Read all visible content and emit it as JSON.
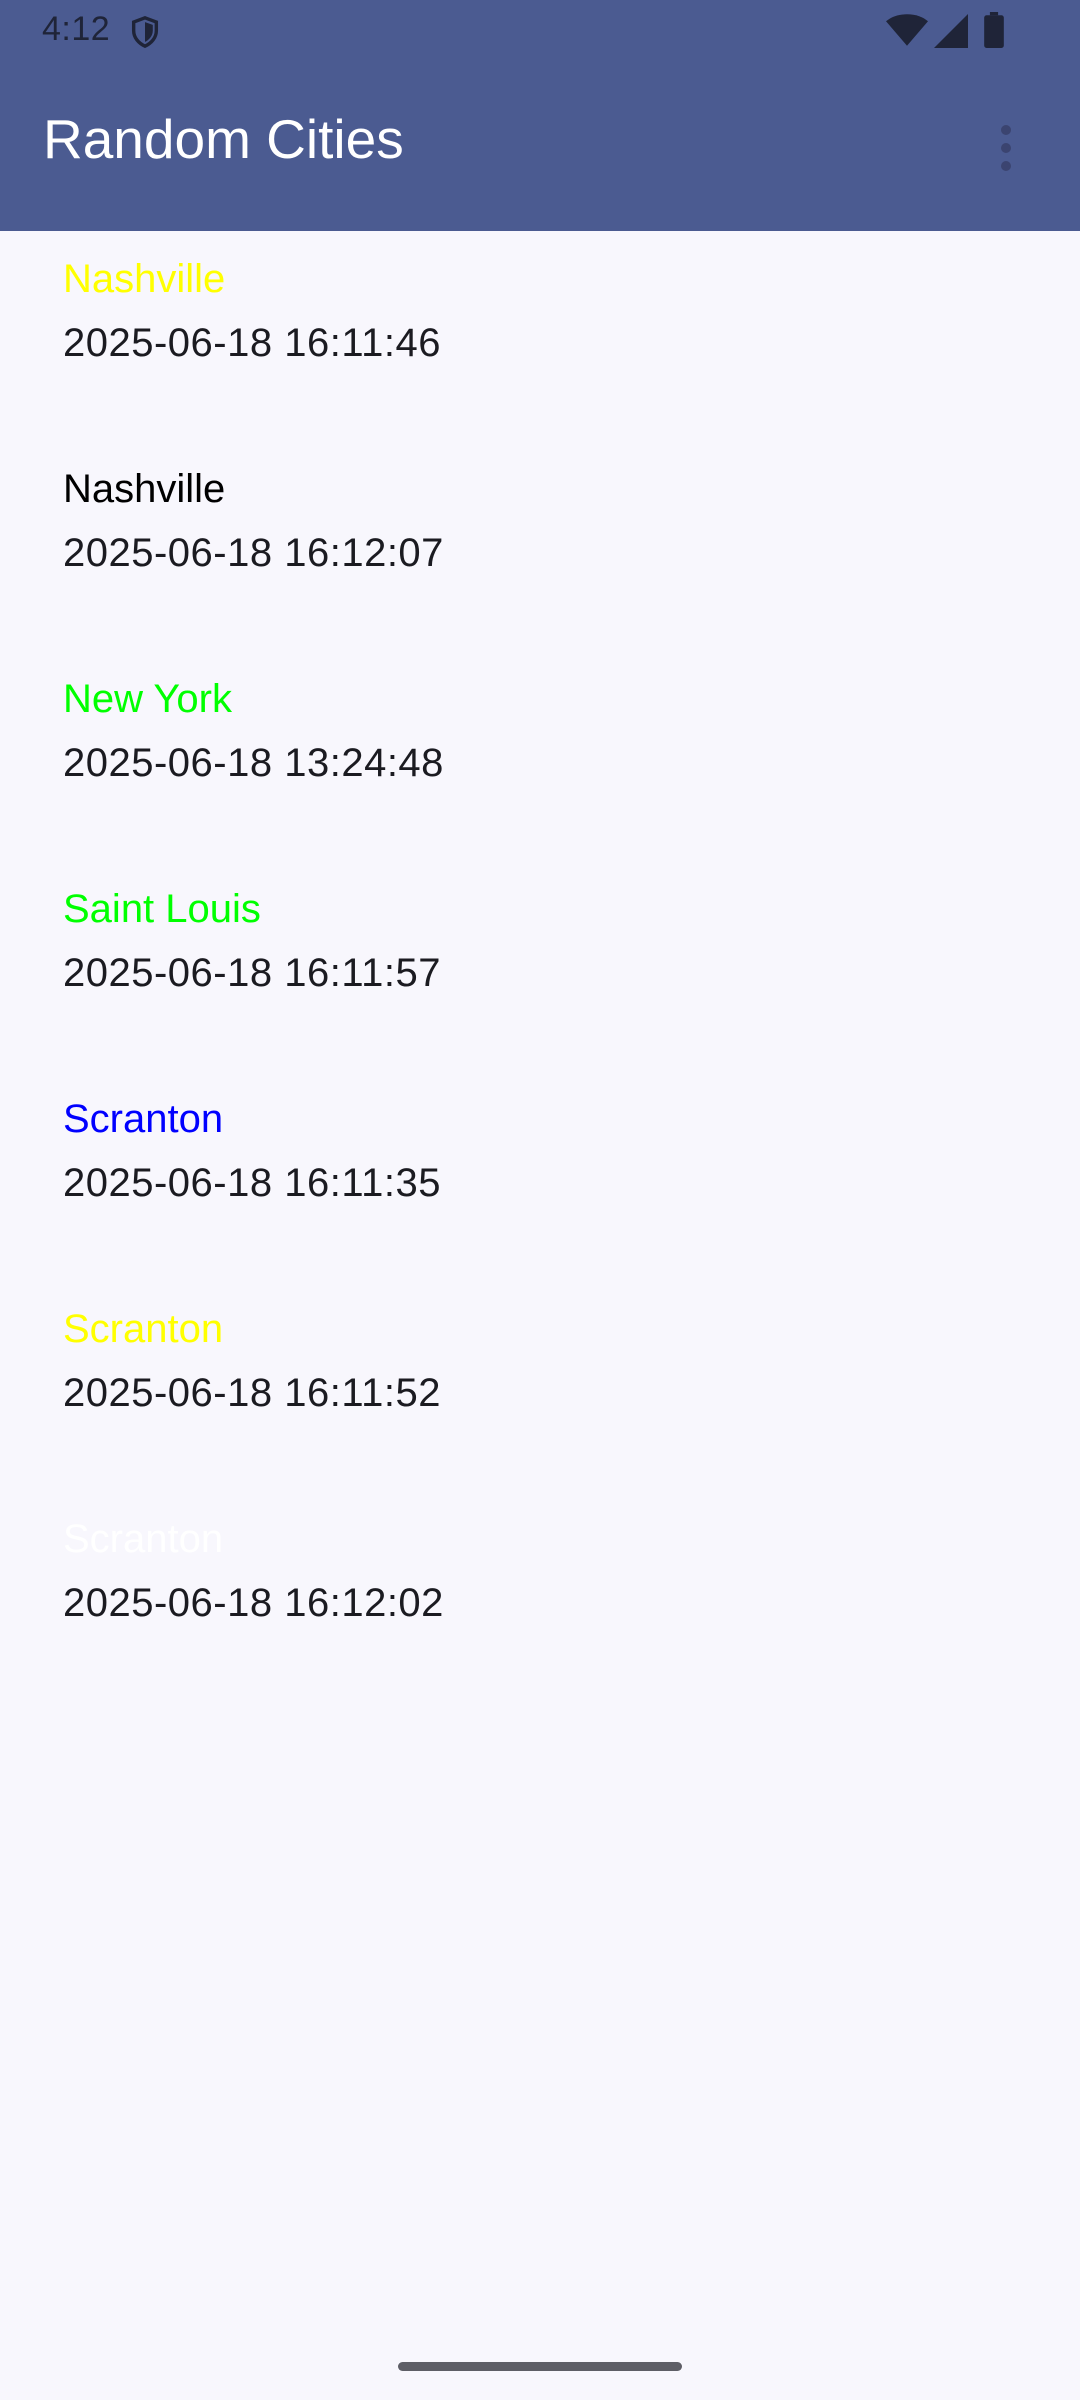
{
  "status_bar": {
    "time": "4:12",
    "icons": [
      "shield-icon",
      "wifi-icon",
      "cellular-signal-icon",
      "battery-icon"
    ]
  },
  "app_bar": {
    "title": "Random Cities",
    "menu_icon": "more-vert-icon",
    "background_color": "#4b5b91"
  },
  "cities": [
    {
      "name": "Nashville",
      "timestamp": "2025-06-18 16:11:46",
      "color": "#ffff00"
    },
    {
      "name": "Nashville",
      "timestamp": "2025-06-18 16:12:07",
      "color": "#000000"
    },
    {
      "name": "New York",
      "timestamp": "2025-06-18 13:24:48",
      "color": "#00ff00"
    },
    {
      "name": "Saint Louis",
      "timestamp": "2025-06-18 16:11:57",
      "color": "#00ff00"
    },
    {
      "name": "Scranton",
      "timestamp": "2025-06-18 16:11:35",
      "color": "#0000ff"
    },
    {
      "name": "Scranton",
      "timestamp": "2025-06-18 16:11:52",
      "color": "#ffff00"
    },
    {
      "name": "Scranton",
      "timestamp": "2025-06-18 16:12:02",
      "color": "#ffffff"
    }
  ]
}
